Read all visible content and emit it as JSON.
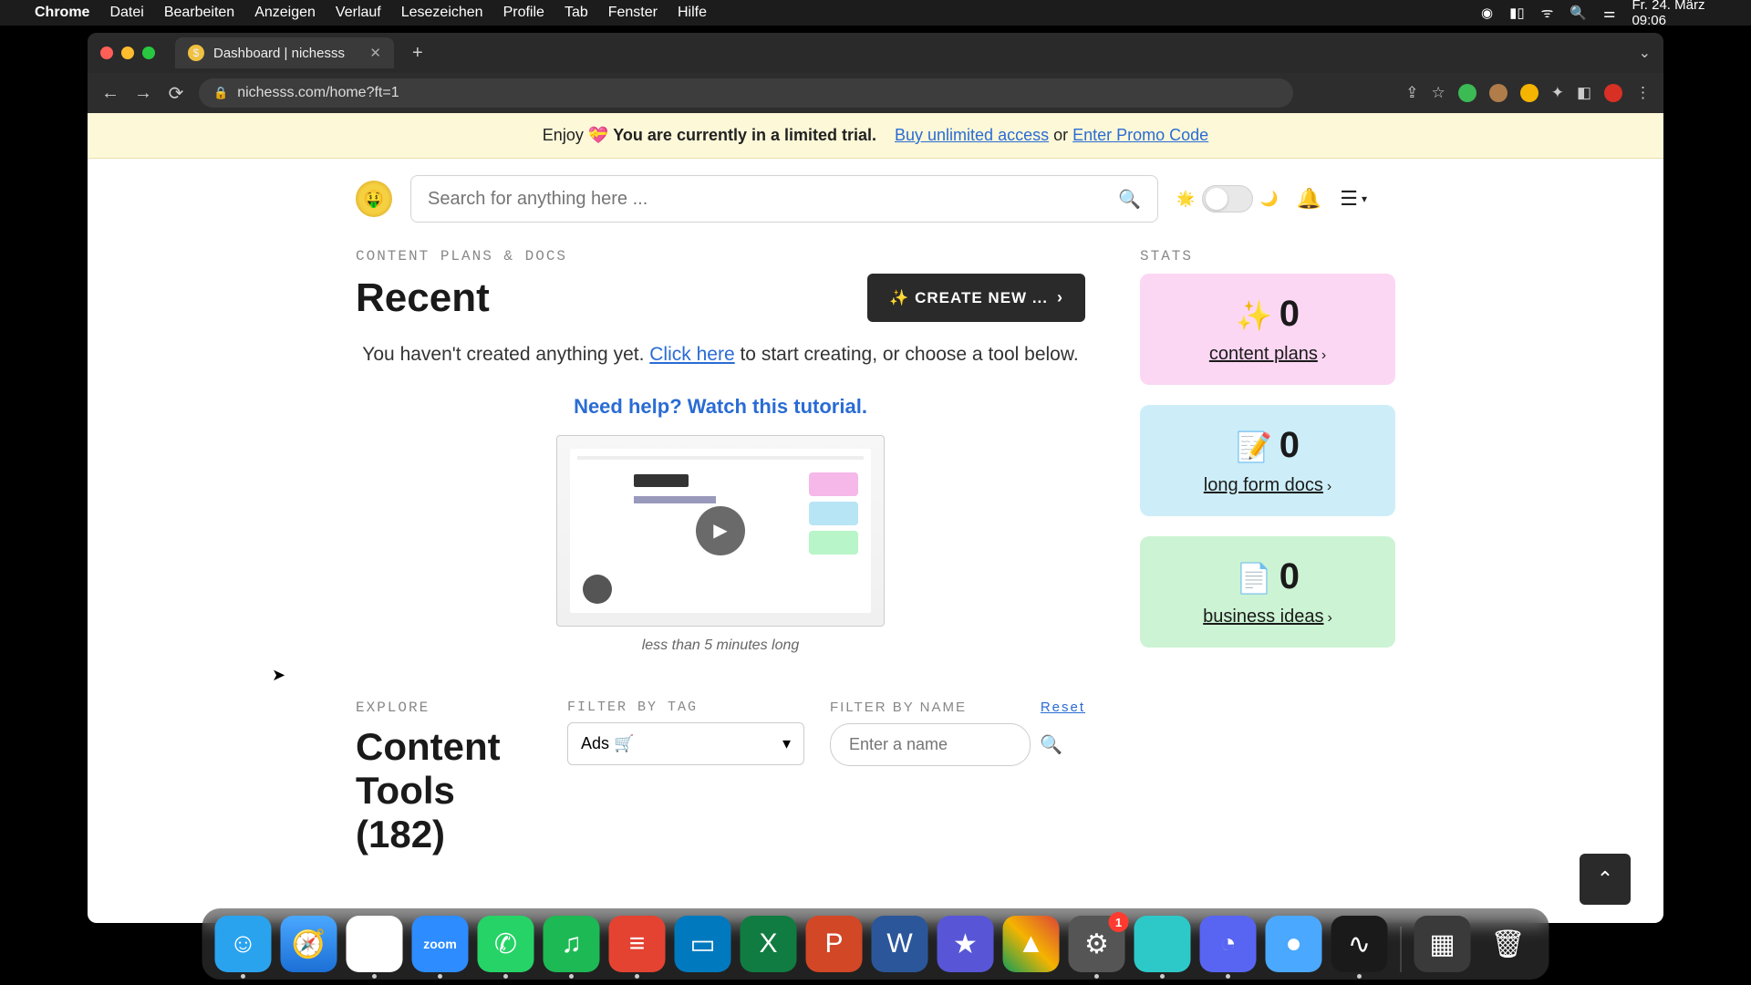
{
  "menubar": {
    "app": "Chrome",
    "items": [
      "Datei",
      "Bearbeiten",
      "Anzeigen",
      "Verlauf",
      "Lesezeichen",
      "Profile",
      "Tab",
      "Fenster",
      "Hilfe"
    ],
    "clock": "Fr. 24. März  09:06"
  },
  "browser": {
    "tab_title": "Dashboard | nichesss",
    "url": "nichesss.com/home?ft=1"
  },
  "banner": {
    "prefix": "Enjoy ",
    "bold": "You are currently in a limited trial.",
    "buy": "Buy unlimited access",
    "or": " or ",
    "promo": "Enter Promo Code"
  },
  "search": {
    "placeholder": "Search for anything here ..."
  },
  "section": {
    "eyebrow": "CONTENT PLANS & DOCS",
    "heading": "Recent",
    "create_btn": "✨ CREATE NEW ...",
    "empty_pre": "You haven't created anything yet. ",
    "empty_link": "Click here",
    "empty_post": " to start creating, or choose a tool below.",
    "help_title": "Need help? Watch this tutorial.",
    "video_caption": "less than 5 minutes long"
  },
  "stats": {
    "eyebrow": "STATS",
    "cards": [
      {
        "emoji": "✨",
        "value": "0",
        "label": "content plans"
      },
      {
        "emoji": "📝",
        "value": "0",
        "label": "long form docs"
      },
      {
        "emoji": "📄",
        "value": "0",
        "label": "business ideas"
      }
    ]
  },
  "explore": {
    "eyebrow": "EXPLORE",
    "heading": "Content Tools (182)",
    "filter_tag_label": "FILTER BY TAG",
    "filter_tag_value": "Ads 🛒",
    "filter_name_label": "FILTER BY NAME",
    "reset": "Reset",
    "name_placeholder": "Enter a name"
  },
  "dock": {
    "apps": [
      {
        "name": "finder",
        "bg": "#2aa3ef",
        "glyph": "☺",
        "running": true
      },
      {
        "name": "safari",
        "bg": "linear-gradient(#4aa8ff,#1c6fd6)",
        "glyph": "🧭",
        "running": false
      },
      {
        "name": "chrome",
        "bg": "#fff",
        "glyph": "◉",
        "running": true
      },
      {
        "name": "zoom",
        "bg": "#2d8cff",
        "glyph": "zoom",
        "text": true,
        "running": true
      },
      {
        "name": "whatsapp",
        "bg": "#25d366",
        "glyph": "✆",
        "running": true
      },
      {
        "name": "spotify",
        "bg": "#1db954",
        "glyph": "♫",
        "running": true
      },
      {
        "name": "todoist",
        "bg": "#e44332",
        "glyph": "≡",
        "running": true
      },
      {
        "name": "trello",
        "bg": "#0079bf",
        "glyph": "▭",
        "running": false
      },
      {
        "name": "excel",
        "bg": "#107c41",
        "glyph": "X",
        "running": false
      },
      {
        "name": "powerpoint",
        "bg": "#d24726",
        "glyph": "P",
        "running": false
      },
      {
        "name": "word",
        "bg": "#2b579a",
        "glyph": "W",
        "running": false
      },
      {
        "name": "imovie",
        "bg": "#5856d6",
        "glyph": "★",
        "running": false
      },
      {
        "name": "drive",
        "bg": "linear-gradient(45deg,#0f9d58,#f4b400,#db4437)",
        "glyph": "▲",
        "running": false
      },
      {
        "name": "settings",
        "bg": "#555",
        "glyph": "⚙",
        "running": true,
        "badge": "1"
      },
      {
        "name": "app-teal",
        "bg": "#2dc9c9",
        "glyph": "",
        "running": true
      },
      {
        "name": "discord",
        "bg": "#5865f2",
        "glyph": "◔",
        "running": true
      },
      {
        "name": "browser2",
        "bg": "#4aa8ff",
        "glyph": "●",
        "running": false
      },
      {
        "name": "voice",
        "bg": "#1a1a1a",
        "glyph": "∿",
        "running": true
      }
    ],
    "right": [
      {
        "name": "app-grid",
        "bg": "#3a3a3a",
        "glyph": "▦"
      },
      {
        "name": "trash",
        "bg": "transparent",
        "glyph": "🗑"
      }
    ]
  }
}
